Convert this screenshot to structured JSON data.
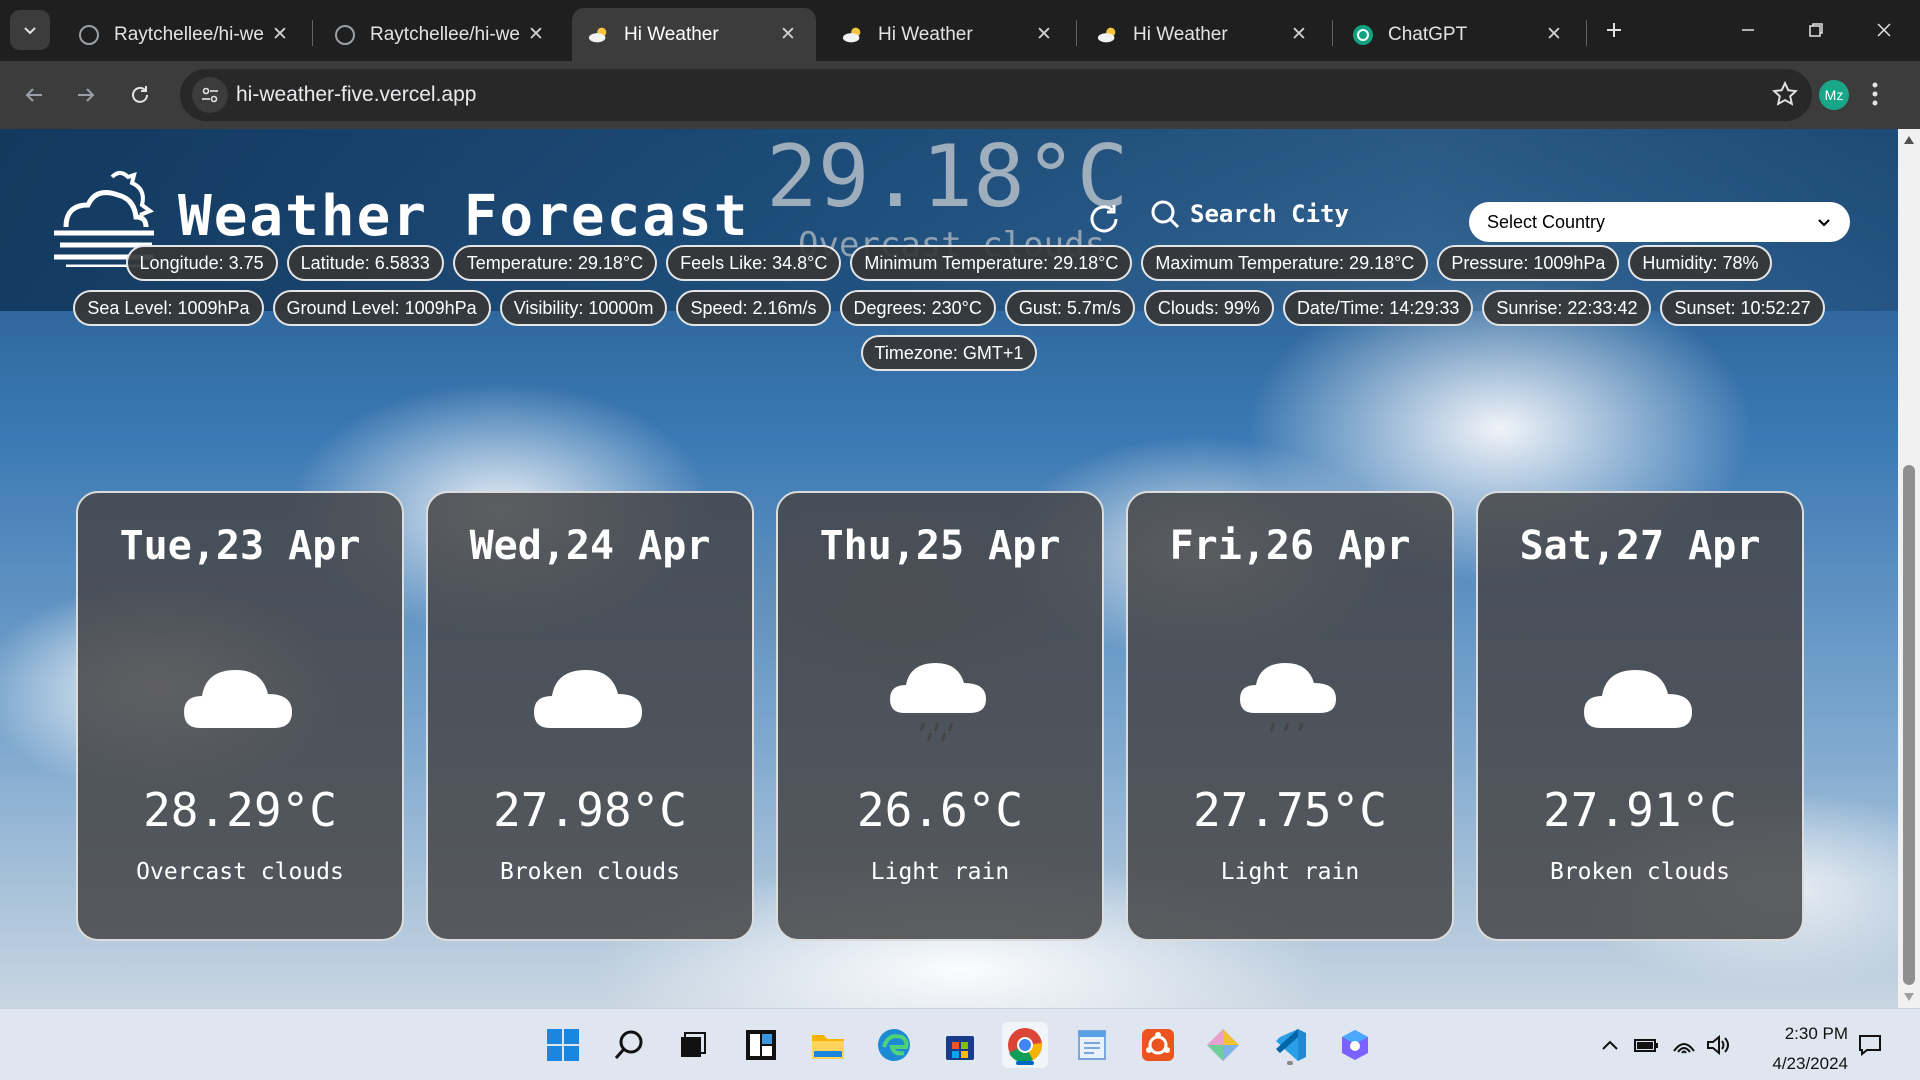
{
  "browser": {
    "tabs": [
      {
        "title": "Raytchellee/hi-we",
        "icon": "github-icon",
        "active": false
      },
      {
        "title": "Raytchellee/hi-we",
        "icon": "github-icon",
        "active": false
      },
      {
        "title": "Hi Weather",
        "icon": "weather-icon",
        "active": true
      },
      {
        "title": "Hi Weather",
        "icon": "weather-icon",
        "active": false
      },
      {
        "title": "Hi Weather",
        "icon": "weather-icon",
        "active": false
      },
      {
        "title": "ChatGPT",
        "icon": "chatgpt-icon",
        "active": false
      }
    ],
    "url": "hi-weather-five.vercel.app",
    "profile_initials": "Mz"
  },
  "header": {
    "title": "Weather Forecast",
    "current_temp": "29.18°C",
    "current_desc": "Overcast clouds",
    "search_label": "Search City",
    "country_select": "Select Country"
  },
  "details": {
    "row1": [
      "Longitude: 3.75",
      "Latitude: 6.5833",
      "Temperature: 29.18°C",
      "Feels Like: 34.8°C",
      "Minimum Temperature: 29.18°C",
      "Maximum Temperature: 29.18°C",
      "Pressure: 1009hPa",
      "Humidity: 78%"
    ],
    "row2": [
      "Sea Level: 1009hPa",
      "Ground Level: 1009hPa",
      "Visibility: 10000m",
      "Speed: 2.16m/s",
      "Degrees: 230°C",
      "Gust: 5.7m/s",
      "Clouds: 99%",
      "Date/Time: 14:29:33",
      "Sunrise: 22:33:42",
      "Sunset: 10:52:27"
    ],
    "row3": [
      "Timezone: GMT+1"
    ]
  },
  "forecast": [
    {
      "date": "Tue,23 Apr",
      "temp": "28.29°C",
      "desc": "Overcast clouds",
      "icon": "cloud-icon"
    },
    {
      "date": "Wed,24 Apr",
      "temp": "27.98°C",
      "desc": "Broken clouds",
      "icon": "cloud-icon"
    },
    {
      "date": "Thu,25 Apr",
      "temp": "26.6°C",
      "desc": "Light rain",
      "icon": "rain-cloud-icon"
    },
    {
      "date": "Fri,26 Apr",
      "temp": "27.75°C",
      "desc": "Light rain",
      "icon": "rain-cloud-icon"
    },
    {
      "date": "Sat,27 Apr",
      "temp": "27.91°C",
      "desc": "Broken clouds",
      "icon": "cloud-icon"
    }
  ],
  "taskbar": {
    "time": "2:30 PM",
    "date": "4/23/2024"
  },
  "colors": {
    "accent": "#1aa789",
    "card_bg": "#464648",
    "chip_bg": "#363636"
  }
}
